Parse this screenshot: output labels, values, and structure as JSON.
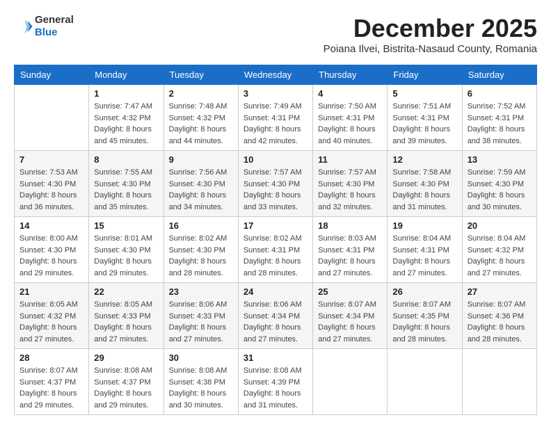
{
  "header": {
    "logo_general": "General",
    "logo_blue": "Blue",
    "month_title": "December 2025",
    "subtitle": "Poiana Ilvei, Bistrita-Nasaud County, Romania"
  },
  "days_of_week": [
    "Sunday",
    "Monday",
    "Tuesday",
    "Wednesday",
    "Thursday",
    "Friday",
    "Saturday"
  ],
  "weeks": [
    [
      {
        "day": "",
        "info": ""
      },
      {
        "day": "1",
        "info": "Sunrise: 7:47 AM\nSunset: 4:32 PM\nDaylight: 8 hours\nand 45 minutes."
      },
      {
        "day": "2",
        "info": "Sunrise: 7:48 AM\nSunset: 4:32 PM\nDaylight: 8 hours\nand 44 minutes."
      },
      {
        "day": "3",
        "info": "Sunrise: 7:49 AM\nSunset: 4:31 PM\nDaylight: 8 hours\nand 42 minutes."
      },
      {
        "day": "4",
        "info": "Sunrise: 7:50 AM\nSunset: 4:31 PM\nDaylight: 8 hours\nand 40 minutes."
      },
      {
        "day": "5",
        "info": "Sunrise: 7:51 AM\nSunset: 4:31 PM\nDaylight: 8 hours\nand 39 minutes."
      },
      {
        "day": "6",
        "info": "Sunrise: 7:52 AM\nSunset: 4:31 PM\nDaylight: 8 hours\nand 38 minutes."
      }
    ],
    [
      {
        "day": "7",
        "info": "Sunrise: 7:53 AM\nSunset: 4:30 PM\nDaylight: 8 hours\nand 36 minutes."
      },
      {
        "day": "8",
        "info": "Sunrise: 7:55 AM\nSunset: 4:30 PM\nDaylight: 8 hours\nand 35 minutes."
      },
      {
        "day": "9",
        "info": "Sunrise: 7:56 AM\nSunset: 4:30 PM\nDaylight: 8 hours\nand 34 minutes."
      },
      {
        "day": "10",
        "info": "Sunrise: 7:57 AM\nSunset: 4:30 PM\nDaylight: 8 hours\nand 33 minutes."
      },
      {
        "day": "11",
        "info": "Sunrise: 7:57 AM\nSunset: 4:30 PM\nDaylight: 8 hours\nand 32 minutes."
      },
      {
        "day": "12",
        "info": "Sunrise: 7:58 AM\nSunset: 4:30 PM\nDaylight: 8 hours\nand 31 minutes."
      },
      {
        "day": "13",
        "info": "Sunrise: 7:59 AM\nSunset: 4:30 PM\nDaylight: 8 hours\nand 30 minutes."
      }
    ],
    [
      {
        "day": "14",
        "info": "Sunrise: 8:00 AM\nSunset: 4:30 PM\nDaylight: 8 hours\nand 29 minutes."
      },
      {
        "day": "15",
        "info": "Sunrise: 8:01 AM\nSunset: 4:30 PM\nDaylight: 8 hours\nand 29 minutes."
      },
      {
        "day": "16",
        "info": "Sunrise: 8:02 AM\nSunset: 4:30 PM\nDaylight: 8 hours\nand 28 minutes."
      },
      {
        "day": "17",
        "info": "Sunrise: 8:02 AM\nSunset: 4:31 PM\nDaylight: 8 hours\nand 28 minutes."
      },
      {
        "day": "18",
        "info": "Sunrise: 8:03 AM\nSunset: 4:31 PM\nDaylight: 8 hours\nand 27 minutes."
      },
      {
        "day": "19",
        "info": "Sunrise: 8:04 AM\nSunset: 4:31 PM\nDaylight: 8 hours\nand 27 minutes."
      },
      {
        "day": "20",
        "info": "Sunrise: 8:04 AM\nSunset: 4:32 PM\nDaylight: 8 hours\nand 27 minutes."
      }
    ],
    [
      {
        "day": "21",
        "info": "Sunrise: 8:05 AM\nSunset: 4:32 PM\nDaylight: 8 hours\nand 27 minutes."
      },
      {
        "day": "22",
        "info": "Sunrise: 8:05 AM\nSunset: 4:33 PM\nDaylight: 8 hours\nand 27 minutes."
      },
      {
        "day": "23",
        "info": "Sunrise: 8:06 AM\nSunset: 4:33 PM\nDaylight: 8 hours\nand 27 minutes."
      },
      {
        "day": "24",
        "info": "Sunrise: 8:06 AM\nSunset: 4:34 PM\nDaylight: 8 hours\nand 27 minutes."
      },
      {
        "day": "25",
        "info": "Sunrise: 8:07 AM\nSunset: 4:34 PM\nDaylight: 8 hours\nand 27 minutes."
      },
      {
        "day": "26",
        "info": "Sunrise: 8:07 AM\nSunset: 4:35 PM\nDaylight: 8 hours\nand 28 minutes."
      },
      {
        "day": "27",
        "info": "Sunrise: 8:07 AM\nSunset: 4:36 PM\nDaylight: 8 hours\nand 28 minutes."
      }
    ],
    [
      {
        "day": "28",
        "info": "Sunrise: 8:07 AM\nSunset: 4:37 PM\nDaylight: 8 hours\nand 29 minutes."
      },
      {
        "day": "29",
        "info": "Sunrise: 8:08 AM\nSunset: 4:37 PM\nDaylight: 8 hours\nand 29 minutes."
      },
      {
        "day": "30",
        "info": "Sunrise: 8:08 AM\nSunset: 4:38 PM\nDaylight: 8 hours\nand 30 minutes."
      },
      {
        "day": "31",
        "info": "Sunrise: 8:08 AM\nSunset: 4:39 PM\nDaylight: 8 hours\nand 31 minutes."
      },
      {
        "day": "",
        "info": ""
      },
      {
        "day": "",
        "info": ""
      },
      {
        "day": "",
        "info": ""
      }
    ]
  ]
}
